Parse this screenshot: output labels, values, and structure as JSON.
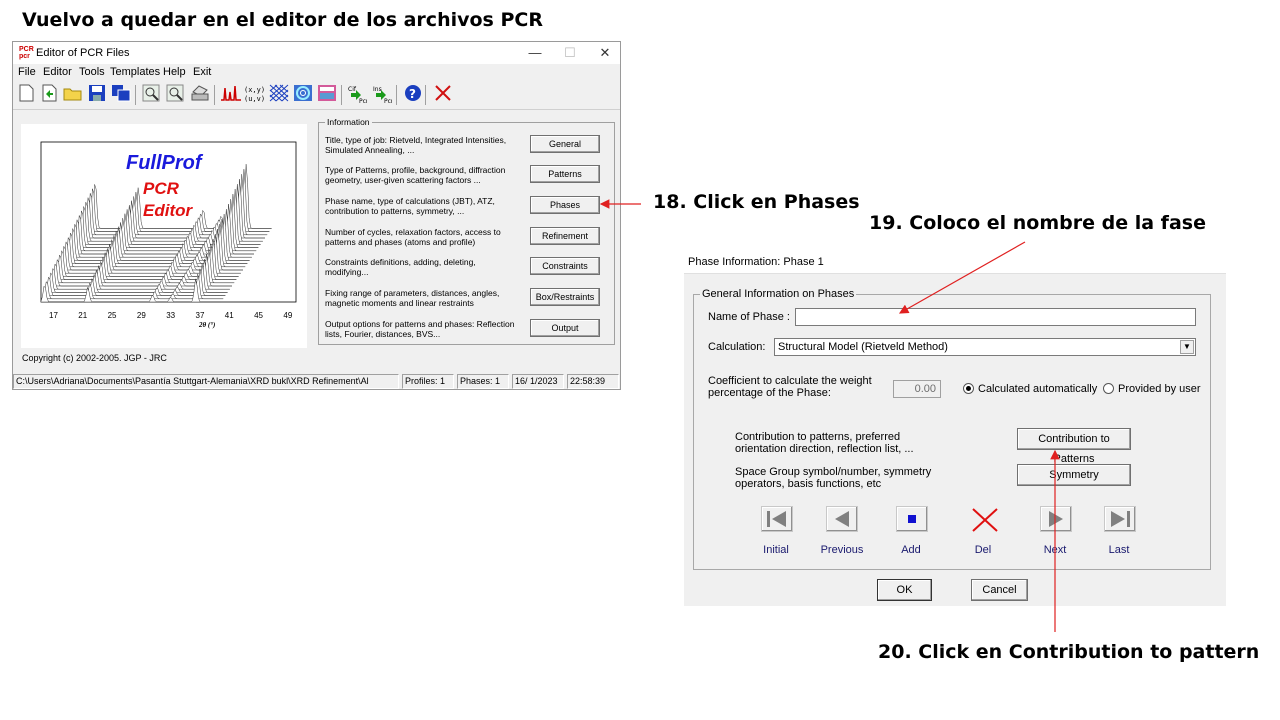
{
  "captions": {
    "heading": "Vuelvo a quedar en el editor de los archivos PCR",
    "step18": "18. Click en Phases",
    "step19": "19. Coloco el nombre de la fase",
    "step20": "20. Click en Contribution to pattern"
  },
  "editor": {
    "title": "Editor of PCR Files",
    "menu": [
      "File",
      "Editor",
      "Tools",
      "Templates",
      "Help",
      "Exit"
    ],
    "toolbar_icons": [
      "new-file-icon",
      "green-arrow-icon",
      "open-folder-icon",
      "save-icon",
      "save-all-icon",
      "zoom-icon",
      "find-icon",
      "print-icon",
      "pattern-icon",
      "matrix-icon",
      "grid-icon",
      "fourier-icon",
      "calculator-icon",
      "convert-cif-icon",
      "convert-ins-icon",
      "help-icon",
      "close-x-icon"
    ],
    "preview": {
      "logo_line1": "FullProf",
      "logo_line2": "PCR",
      "logo_line3": "Editor",
      "x_ticks": [
        "17",
        "21",
        "25",
        "29",
        "33",
        "37",
        "41",
        "45",
        "49"
      ],
      "x_label": "2θ (°)"
    },
    "copyright": "Copyright (c) 2002-2005. JGP - JRC",
    "info_legend": "Information",
    "info_rows": [
      {
        "text": "Title, type of job: Rietveld, Integrated Intensities, Simulated Annealing, ...",
        "button": "General"
      },
      {
        "text": "Type of Patterns, profile, background, diffraction geometry, user-given scattering factors ...",
        "button": "Patterns"
      },
      {
        "text": "Phase name, type of calculations (JBT),  ATZ, contribution to patterns, symmetry, ...",
        "button": "Phases"
      },
      {
        "text": "Number of cycles, relaxation factors, access to patterns and phases (atoms and profile)",
        "button": "Refinement"
      },
      {
        "text": "Constraints definitions, adding, deleting, modifying...",
        "button": "Constraints"
      },
      {
        "text": "Fixing range of parameters, distances, angles, magnetic moments and linear restraints",
        "button": "Box/Restraints"
      },
      {
        "text": "Output options for patterns and phases: Reflection lists, Fourier, distances, BVS...",
        "button": "Output"
      }
    ],
    "status": {
      "path": "C:\\Users\\Adriana\\Documents\\Pasantía Stuttgart-Alemania\\XRD bukl\\XRD Refinement\\Al",
      "profiles": "Profiles:  1",
      "phases": "Phases:  1",
      "date": "16/ 1/2023",
      "time": "22:58:39"
    }
  },
  "phase_dialog": {
    "title": "Phase Information: Phase 1",
    "group_legend": "General Information on Phases",
    "name_label": "Name of Phase :",
    "name_value": "",
    "calc_label": "Calculation:",
    "calc_value": "Structural Model (Rietveld Method)",
    "coef_label_1": "Coefficient to calculate the weight",
    "coef_label_2": "percentage of the Phase:",
    "coef_value": "0.00",
    "radio_auto": "Calculated automatically",
    "radio_user": "Provided by user",
    "contrib_text_1": "Contribution to patterns, preferred",
    "contrib_text_2": "orientation direction, reflection list, ...",
    "contrib_button": "Contribution to Patterns",
    "sym_text_1": "Space Group symbol/number, symmetry",
    "sym_text_2": "operators, basis functions, etc",
    "sym_button": "Symmetry",
    "nav": [
      "Initial",
      "Previous",
      "Add",
      "Del",
      "Next",
      "Last"
    ],
    "ok": "OK",
    "cancel": "Cancel"
  },
  "colors": {
    "arrow": "#e02020",
    "logo_blue": "#1a1adc",
    "logo_red": "#e01010"
  }
}
